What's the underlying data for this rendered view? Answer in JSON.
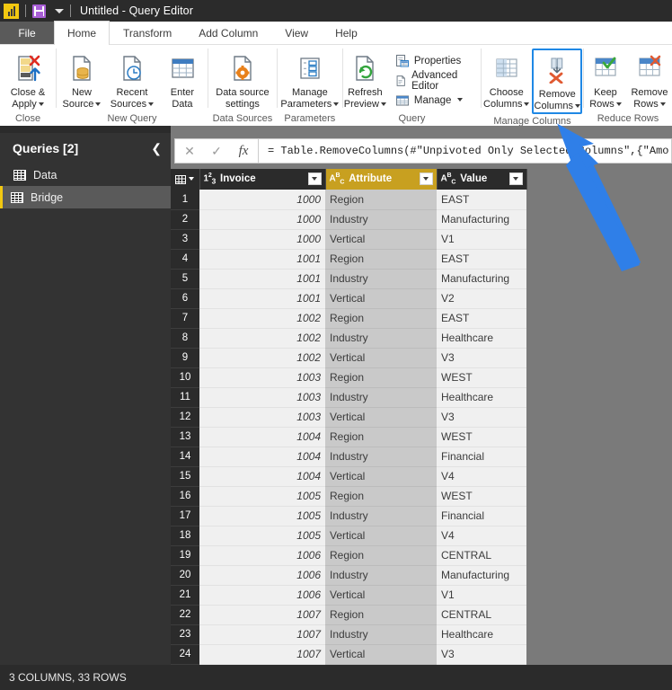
{
  "titlebar": {
    "app_icon": "powerbi-logo-icon",
    "save_icon": "save-icon",
    "qat_caret_icon": "chevron-down-icon",
    "title": "Untitled - Query Editor"
  },
  "tabs": [
    {
      "label": "File",
      "active": false
    },
    {
      "label": "Home",
      "active": true
    },
    {
      "label": "Transform",
      "active": false
    },
    {
      "label": "Add Column",
      "active": false
    },
    {
      "label": "View",
      "active": false
    },
    {
      "label": "Help",
      "active": false
    }
  ],
  "ribbon": {
    "groups": [
      {
        "label": "Close",
        "buttons": [
          {
            "label": "Close &\nApply",
            "line1": "Close &",
            "line2": "Apply",
            "icon": "close-and-apply-icon",
            "has_caret": true
          }
        ]
      },
      {
        "label": "New Query",
        "buttons": [
          {
            "line1": "New",
            "line2": "Source",
            "icon": "new-source-icon",
            "has_caret": true
          },
          {
            "line1": "Recent",
            "line2": "Sources",
            "icon": "recent-sources-icon",
            "has_caret": true
          },
          {
            "line1": "Enter",
            "line2": "Data",
            "icon": "enter-data-icon",
            "has_caret": false
          }
        ]
      },
      {
        "label": "Data Sources",
        "buttons": [
          {
            "line1": "Data source",
            "line2": "settings",
            "icon": "data-source-settings-icon",
            "has_caret": false
          }
        ]
      },
      {
        "label": "Parameters",
        "buttons": [
          {
            "line1": "Manage",
            "line2": "Parameters",
            "icon": "manage-parameters-icon",
            "has_caret": true
          }
        ]
      },
      {
        "label": "Query",
        "buttons": [
          {
            "line1": "Refresh",
            "line2": "Preview",
            "icon": "refresh-preview-icon",
            "has_caret": true
          }
        ],
        "small_buttons": [
          {
            "label": "Properties",
            "icon": "properties-icon",
            "has_caret": false
          },
          {
            "label": "Advanced Editor",
            "icon": "advanced-editor-icon",
            "has_caret": false
          },
          {
            "label": "Manage",
            "icon": "manage-icon",
            "has_caret": true
          }
        ]
      },
      {
        "label": "Manage Columns",
        "buttons": [
          {
            "line1": "Choose",
            "line2": "Columns",
            "icon": "choose-columns-icon",
            "has_caret": true,
            "selected": false
          },
          {
            "line1": "Remove",
            "line2": "Columns",
            "icon": "remove-columns-icon",
            "has_caret": true,
            "selected": true
          }
        ]
      },
      {
        "label": "Reduce Rows",
        "buttons": [
          {
            "line1": "Keep",
            "line2": "Rows",
            "icon": "keep-rows-icon",
            "has_caret": true
          },
          {
            "line1": "Remove",
            "line2": "Rows",
            "icon": "remove-rows-icon",
            "has_caret": true
          }
        ]
      }
    ]
  },
  "queries_pane": {
    "title": "Queries [2]",
    "collapse_icon": "chevron-left-icon",
    "items": [
      {
        "label": "Data",
        "icon": "table-icon",
        "selected": false
      },
      {
        "label": "Bridge",
        "icon": "table-icon",
        "selected": true
      }
    ]
  },
  "formula_bar": {
    "cancel_icon": "close-icon",
    "accept_icon": "check-icon",
    "fx_icon": "fx-icon",
    "value": "= Table.RemoveColumns(#\"Unpivoted Only Selected Columns\",{\"Amo"
  },
  "grid": {
    "corner_icon": "select-all-icon",
    "filter_icon": "filter-dropdown-icon",
    "columns": [
      {
        "name": "Invoice",
        "type_badge": "1 2 3",
        "type": "number",
        "selected": false
      },
      {
        "name": "Attribute",
        "type_badge": "A B C",
        "type": "text",
        "selected": true
      },
      {
        "name": "Value",
        "type_badge": "A B C",
        "type": "text",
        "selected": false
      }
    ],
    "rows": [
      {
        "n": "1",
        "invoice": "1000",
        "attribute": "Region",
        "value": "EAST"
      },
      {
        "n": "2",
        "invoice": "1000",
        "attribute": "Industry",
        "value": "Manufacturing"
      },
      {
        "n": "3",
        "invoice": "1000",
        "attribute": "Vertical",
        "value": "V1"
      },
      {
        "n": "4",
        "invoice": "1001",
        "attribute": "Region",
        "value": "EAST"
      },
      {
        "n": "5",
        "invoice": "1001",
        "attribute": "Industry",
        "value": "Manufacturing"
      },
      {
        "n": "6",
        "invoice": "1001",
        "attribute": "Vertical",
        "value": "V2"
      },
      {
        "n": "7",
        "invoice": "1002",
        "attribute": "Region",
        "value": "EAST"
      },
      {
        "n": "8",
        "invoice": "1002",
        "attribute": "Industry",
        "value": "Healthcare"
      },
      {
        "n": "9",
        "invoice": "1002",
        "attribute": "Vertical",
        "value": "V3"
      },
      {
        "n": "10",
        "invoice": "1003",
        "attribute": "Region",
        "value": "WEST"
      },
      {
        "n": "11",
        "invoice": "1003",
        "attribute": "Industry",
        "value": "Healthcare"
      },
      {
        "n": "12",
        "invoice": "1003",
        "attribute": "Vertical",
        "value": "V3"
      },
      {
        "n": "13",
        "invoice": "1004",
        "attribute": "Region",
        "value": "WEST"
      },
      {
        "n": "14",
        "invoice": "1004",
        "attribute": "Industry",
        "value": "Financial"
      },
      {
        "n": "15",
        "invoice": "1004",
        "attribute": "Vertical",
        "value": "V4"
      },
      {
        "n": "16",
        "invoice": "1005",
        "attribute": "Region",
        "value": "WEST"
      },
      {
        "n": "17",
        "invoice": "1005",
        "attribute": "Industry",
        "value": "Financial"
      },
      {
        "n": "18",
        "invoice": "1005",
        "attribute": "Vertical",
        "value": "V4"
      },
      {
        "n": "19",
        "invoice": "1006",
        "attribute": "Region",
        "value": "CENTRAL"
      },
      {
        "n": "20",
        "invoice": "1006",
        "attribute": "Industry",
        "value": "Manufacturing"
      },
      {
        "n": "21",
        "invoice": "1006",
        "attribute": "Vertical",
        "value": "V1"
      },
      {
        "n": "22",
        "invoice": "1007",
        "attribute": "Region",
        "value": "CENTRAL"
      },
      {
        "n": "23",
        "invoice": "1007",
        "attribute": "Industry",
        "value": "Healthcare"
      },
      {
        "n": "24",
        "invoice": "1007",
        "attribute": "Vertical",
        "value": "V3"
      }
    ]
  },
  "statusbar": {
    "text": "3 COLUMNS, 33 ROWS"
  },
  "annotation": {
    "type": "arrow",
    "color": "#2f7fe8",
    "points_to": "remove-columns-button"
  },
  "colors": {
    "titlebar_bg": "#2b2b2b",
    "accent_yellow": "#f2c811",
    "selected_column_header": "#c8a020",
    "highlight_box": "#1f88e5",
    "panel_gray": "#7a7a7a"
  }
}
